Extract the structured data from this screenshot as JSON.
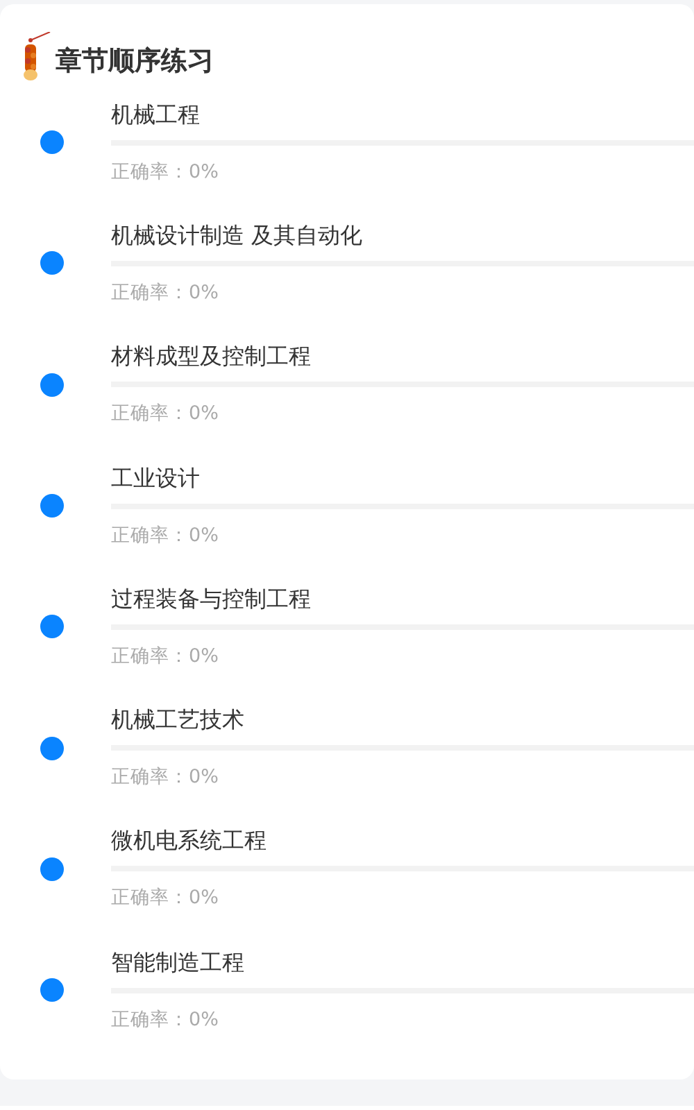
{
  "title": "章节顺序练习",
  "chapters": [
    {
      "name": "机械工程",
      "level": 0,
      "accuracy": "正确率：0%"
    },
    {
      "name": "机械设计制造 及其自动化",
      "level": 0,
      "accuracy": "正确率：0%"
    },
    {
      "name": "材料成型及控制工程",
      "level": 0,
      "accuracy": "正确率：0%"
    },
    {
      "name": "工业设计",
      "level": 0,
      "accuracy": "正确率：0%"
    },
    {
      "name": "过程装备与控制工程",
      "level": 0,
      "accuracy": "正确率：0%"
    },
    {
      "name": "机械工艺技术",
      "level": 0,
      "accuracy": "正确率：0%"
    },
    {
      "name": "微机电系统工程",
      "level": 0,
      "accuracy": "正确率：0%"
    },
    {
      "name": "智能制造工程",
      "level": 0,
      "accuracy": "正确率：0%"
    }
  ]
}
